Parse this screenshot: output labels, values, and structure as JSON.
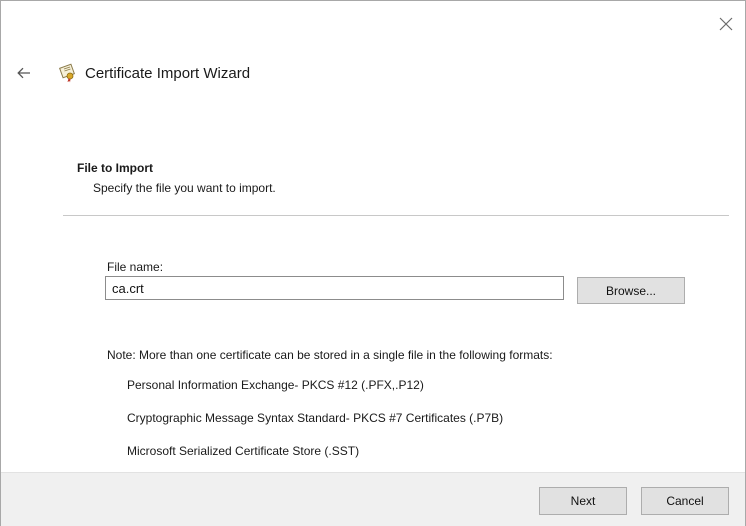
{
  "window": {
    "title": "Certificate Import Wizard",
    "close_icon": "close-icon",
    "back_icon": "back-arrow-icon",
    "wizard_icon": "certificate-icon"
  },
  "section": {
    "heading": "File to Import",
    "description": "Specify the file you want to import."
  },
  "file": {
    "label": "File name:",
    "value": "ca.crt",
    "browse_label": "Browse..."
  },
  "note": {
    "text": "Note:  More than one certificate can be stored in a single file in the following formats:",
    "formats": [
      "Personal Information Exchange- PKCS #12 (.PFX,.P12)",
      "Cryptographic Message Syntax Standard- PKCS #7 Certificates (.P7B)",
      "Microsoft Serialized Certificate Store (.SST)"
    ]
  },
  "footer": {
    "next_label": "Next",
    "cancel_label": "Cancel"
  },
  "colors": {
    "footer_bg": "#f0f0f0",
    "button_bg": "#e1e1e1",
    "divider": "#c8c8c8"
  }
}
